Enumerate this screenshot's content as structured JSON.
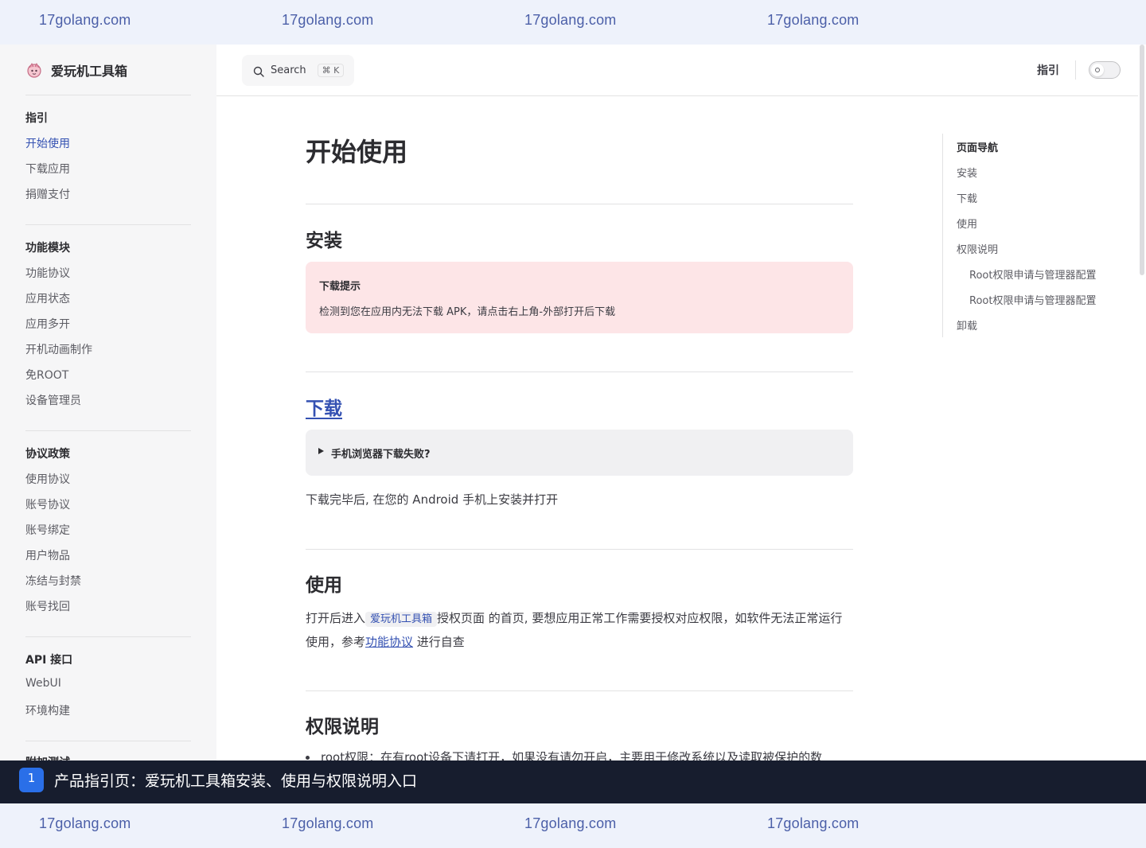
{
  "watermark": {
    "text": "17golang.com"
  },
  "sidebar": {
    "brand": "爱玩机工具箱",
    "groups": [
      {
        "title": "指引",
        "items": [
          "开始使用",
          "下载应用",
          "捐赠支付"
        ]
      },
      {
        "title": "功能模块",
        "items": [
          "功能协议",
          "应用状态",
          "应用多开",
          "开机动画制作",
          "免ROOT",
          "设备管理员"
        ]
      },
      {
        "title": "协议政策",
        "items": [
          "使用协议",
          "账号协议",
          "账号绑定",
          "用户物品",
          "冻结与封禁",
          "账号找回"
        ]
      },
      {
        "title": "API 接口",
        "items": [
          "WebUI",
          "环境构建"
        ]
      },
      {
        "title": "附加测试",
        "items": []
      }
    ],
    "active_item": "开始使用"
  },
  "topnav": {
    "search_label": "Search",
    "search_kbd": "⌘ K",
    "nav_link": "指引"
  },
  "main": {
    "title": "开始使用",
    "sections": {
      "install": {
        "heading": "安装",
        "tip_title": "下载提示",
        "tip_text": "检测到您在应用内无法下载 APK，请点击右上角-外部打开后下载"
      },
      "download": {
        "heading": "下载",
        "details_summary": "手机浏览器下载失败?",
        "text": "下载完毕后, 在您的 Android 手机上安装并打开"
      },
      "usage": {
        "heading": "使用",
        "text_before": "打开后进入",
        "code": "爱玩机工具箱",
        "text_middle": "授权页面 的首页, 要想应用正常工作需要授权对应权限，如软件无法正常运行使用，参考",
        "link": "功能协议",
        "text_after": " 进行自查"
      },
      "permissions": {
        "heading": "权限说明",
        "list_item_partial": "root权限：在有root设备下请打开，如果没有请勿开启，主要用于修改系统以及读取被保护的数"
      }
    }
  },
  "outline": {
    "title": "页面导航",
    "items": [
      {
        "label": "安装",
        "level": 1
      },
      {
        "label": "下载",
        "level": 1
      },
      {
        "label": "使用",
        "level": 1
      },
      {
        "label": "权限说明",
        "level": 1
      },
      {
        "label": "Root权限申请与管理器配置",
        "level": 2
      },
      {
        "label": "Root权限申请与管理器配置",
        "level": 2
      },
      {
        "label": "卸载",
        "level": 1
      }
    ]
  },
  "caption": {
    "badge": "1",
    "text": "产品指引页：爱玩机工具箱安装、使用与权限说明入口"
  },
  "colors": {
    "brand": "#3451b2",
    "tip_bg": "#fde5e7",
    "caption_bg": "#171d2e",
    "watermark_bg": "#eef2fb"
  }
}
